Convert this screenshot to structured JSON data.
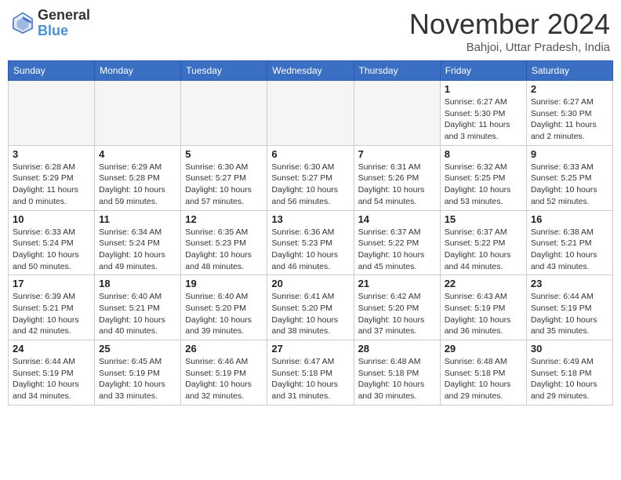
{
  "header": {
    "logo_general": "General",
    "logo_blue": "Blue",
    "month_title": "November 2024",
    "subtitle": "Bahjoi, Uttar Pradesh, India"
  },
  "weekdays": [
    "Sunday",
    "Monday",
    "Tuesday",
    "Wednesday",
    "Thursday",
    "Friday",
    "Saturday"
  ],
  "weeks": [
    [
      {
        "day": "",
        "info": ""
      },
      {
        "day": "",
        "info": ""
      },
      {
        "day": "",
        "info": ""
      },
      {
        "day": "",
        "info": ""
      },
      {
        "day": "",
        "info": ""
      },
      {
        "day": "1",
        "info": "Sunrise: 6:27 AM\nSunset: 5:30 PM\nDaylight: 11 hours\nand 3 minutes."
      },
      {
        "day": "2",
        "info": "Sunrise: 6:27 AM\nSunset: 5:30 PM\nDaylight: 11 hours\nand 2 minutes."
      }
    ],
    [
      {
        "day": "3",
        "info": "Sunrise: 6:28 AM\nSunset: 5:29 PM\nDaylight: 11 hours\nand 0 minutes."
      },
      {
        "day": "4",
        "info": "Sunrise: 6:29 AM\nSunset: 5:28 PM\nDaylight: 10 hours\nand 59 minutes."
      },
      {
        "day": "5",
        "info": "Sunrise: 6:30 AM\nSunset: 5:27 PM\nDaylight: 10 hours\nand 57 minutes."
      },
      {
        "day": "6",
        "info": "Sunrise: 6:30 AM\nSunset: 5:27 PM\nDaylight: 10 hours\nand 56 minutes."
      },
      {
        "day": "7",
        "info": "Sunrise: 6:31 AM\nSunset: 5:26 PM\nDaylight: 10 hours\nand 54 minutes."
      },
      {
        "day": "8",
        "info": "Sunrise: 6:32 AM\nSunset: 5:25 PM\nDaylight: 10 hours\nand 53 minutes."
      },
      {
        "day": "9",
        "info": "Sunrise: 6:33 AM\nSunset: 5:25 PM\nDaylight: 10 hours\nand 52 minutes."
      }
    ],
    [
      {
        "day": "10",
        "info": "Sunrise: 6:33 AM\nSunset: 5:24 PM\nDaylight: 10 hours\nand 50 minutes."
      },
      {
        "day": "11",
        "info": "Sunrise: 6:34 AM\nSunset: 5:24 PM\nDaylight: 10 hours\nand 49 minutes."
      },
      {
        "day": "12",
        "info": "Sunrise: 6:35 AM\nSunset: 5:23 PM\nDaylight: 10 hours\nand 48 minutes."
      },
      {
        "day": "13",
        "info": "Sunrise: 6:36 AM\nSunset: 5:23 PM\nDaylight: 10 hours\nand 46 minutes."
      },
      {
        "day": "14",
        "info": "Sunrise: 6:37 AM\nSunset: 5:22 PM\nDaylight: 10 hours\nand 45 minutes."
      },
      {
        "day": "15",
        "info": "Sunrise: 6:37 AM\nSunset: 5:22 PM\nDaylight: 10 hours\nand 44 minutes."
      },
      {
        "day": "16",
        "info": "Sunrise: 6:38 AM\nSunset: 5:21 PM\nDaylight: 10 hours\nand 43 minutes."
      }
    ],
    [
      {
        "day": "17",
        "info": "Sunrise: 6:39 AM\nSunset: 5:21 PM\nDaylight: 10 hours\nand 42 minutes."
      },
      {
        "day": "18",
        "info": "Sunrise: 6:40 AM\nSunset: 5:21 PM\nDaylight: 10 hours\nand 40 minutes."
      },
      {
        "day": "19",
        "info": "Sunrise: 6:40 AM\nSunset: 5:20 PM\nDaylight: 10 hours\nand 39 minutes."
      },
      {
        "day": "20",
        "info": "Sunrise: 6:41 AM\nSunset: 5:20 PM\nDaylight: 10 hours\nand 38 minutes."
      },
      {
        "day": "21",
        "info": "Sunrise: 6:42 AM\nSunset: 5:20 PM\nDaylight: 10 hours\nand 37 minutes."
      },
      {
        "day": "22",
        "info": "Sunrise: 6:43 AM\nSunset: 5:19 PM\nDaylight: 10 hours\nand 36 minutes."
      },
      {
        "day": "23",
        "info": "Sunrise: 6:44 AM\nSunset: 5:19 PM\nDaylight: 10 hours\nand 35 minutes."
      }
    ],
    [
      {
        "day": "24",
        "info": "Sunrise: 6:44 AM\nSunset: 5:19 PM\nDaylight: 10 hours\nand 34 minutes."
      },
      {
        "day": "25",
        "info": "Sunrise: 6:45 AM\nSunset: 5:19 PM\nDaylight: 10 hours\nand 33 minutes."
      },
      {
        "day": "26",
        "info": "Sunrise: 6:46 AM\nSunset: 5:19 PM\nDaylight: 10 hours\nand 32 minutes."
      },
      {
        "day": "27",
        "info": "Sunrise: 6:47 AM\nSunset: 5:18 PM\nDaylight: 10 hours\nand 31 minutes."
      },
      {
        "day": "28",
        "info": "Sunrise: 6:48 AM\nSunset: 5:18 PM\nDaylight: 10 hours\nand 30 minutes."
      },
      {
        "day": "29",
        "info": "Sunrise: 6:48 AM\nSunset: 5:18 PM\nDaylight: 10 hours\nand 29 minutes."
      },
      {
        "day": "30",
        "info": "Sunrise: 6:49 AM\nSunset: 5:18 PM\nDaylight: 10 hours\nand 29 minutes."
      }
    ]
  ]
}
